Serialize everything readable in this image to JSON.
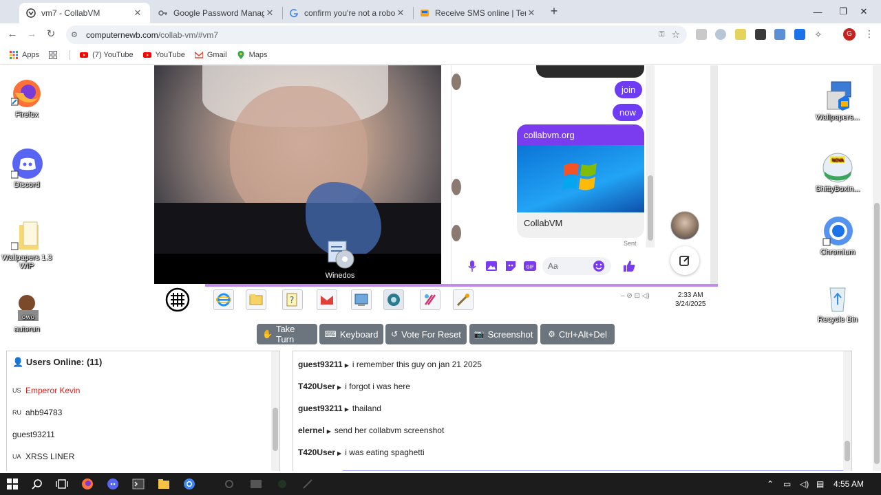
{
  "browser": {
    "tabs": [
      {
        "title": "vm7 - CollabVM",
        "active": true
      },
      {
        "title": "Google Password Manager",
        "active": false
      },
      {
        "title": "confirm you're not a robot goo",
        "active": false
      },
      {
        "title": "Receive SMS online | Tempora",
        "active": false
      }
    ],
    "url_host": "computernewb.com",
    "url_path": "/collab-vm/#vm7"
  },
  "bookmarks": [
    {
      "label": "Apps",
      "icon": "apps-icon"
    },
    {
      "label": "(7) YouTube",
      "icon": "youtube-icon"
    },
    {
      "label": "YouTube",
      "icon": "youtube-icon"
    },
    {
      "label": "Gmail",
      "icon": "gmail-icon"
    },
    {
      "label": "Maps",
      "icon": "maps-icon"
    }
  ],
  "vm_desktop": {
    "icons_left": [
      {
        "label": "Firefox"
      },
      {
        "label": "Discord"
      },
      {
        "label": "Wallpapers 1.3 WIP"
      },
      {
        "label": "autorun"
      }
    ],
    "icons_right": [
      {
        "label": "Wallpapers..."
      },
      {
        "label": "ShittyBoxIn..."
      },
      {
        "label": "Chromium"
      },
      {
        "label": "Recycle Bin"
      }
    ],
    "webcam_icon_label": "Winedos",
    "messenger": {
      "bubbles": [
        "join",
        "now"
      ],
      "card_title": "collabvm.org",
      "card_caption": "CollabVM",
      "sent_label": "Sent",
      "input_placeholder": "Aa"
    },
    "clock_time": "2:33 AM",
    "clock_date": "3/24/2025"
  },
  "vm_buttons": [
    {
      "label": "Take Turn",
      "icon": "turn-icon"
    },
    {
      "label": "Keyboard",
      "icon": "keyboard-icon"
    },
    {
      "label": "Vote For Reset",
      "icon": "reset-icon"
    },
    {
      "label": "Screenshot",
      "icon": "camera-icon"
    },
    {
      "label": "Ctrl+Alt+Del",
      "icon": "gear-icon"
    }
  ],
  "users_panel": {
    "title": "Users Online: (11)",
    "users": [
      {
        "cc": "US",
        "name": "Emperor Kevin",
        "admin": true
      },
      {
        "cc": "RU",
        "name": "ahb94783",
        "admin": false
      },
      {
        "cc": "",
        "name": "guest93211",
        "admin": false
      },
      {
        "cc": "UA",
        "name": "XRSS LINER",
        "admin": false
      }
    ]
  },
  "chat": {
    "messages": [
      {
        "user": "guest93211",
        "text": "i remember this guy on jan 21 2025"
      },
      {
        "user": "T420User",
        "text": "i forgot i was here"
      },
      {
        "user": "guest93211",
        "text": "thailand"
      },
      {
        "user": "elernel",
        "text": "send her collabvm screenshot"
      },
      {
        "user": "T420User",
        "text": "i was eating spaghetti"
      }
    ]
  },
  "host_taskbar": {
    "clock": "4:55 AM"
  },
  "colors": {
    "messenger_purple": "#6e3cf5",
    "admin_red": "#e0221b",
    "button_grey": "#6c757d"
  }
}
